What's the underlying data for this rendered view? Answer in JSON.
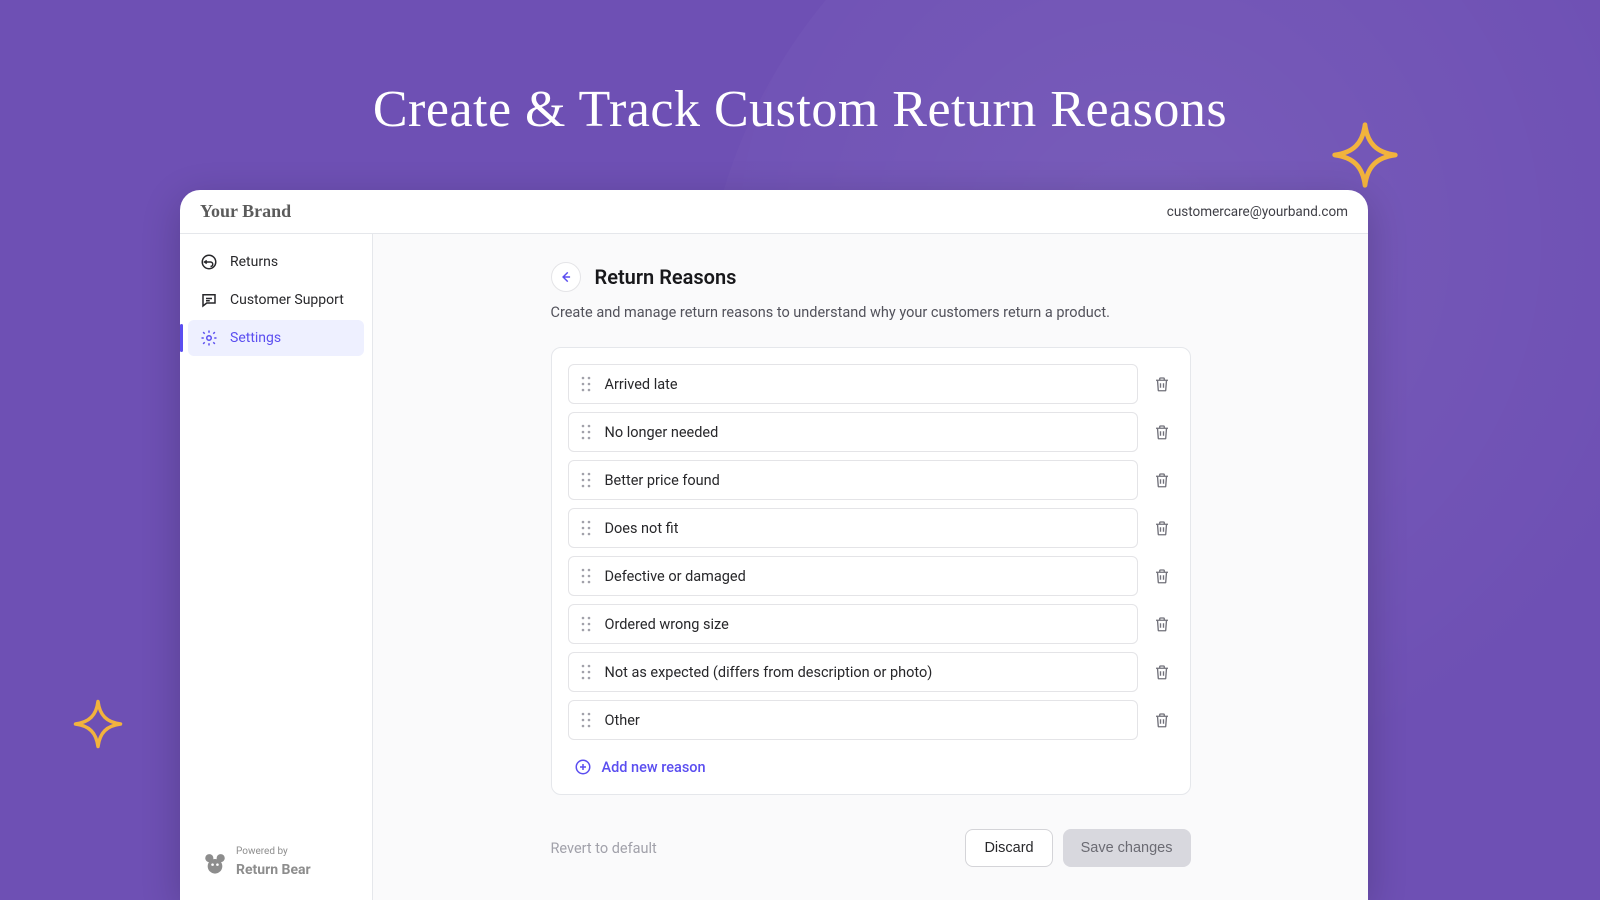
{
  "hero": {
    "title": "Create & Track Custom Return Reasons"
  },
  "header": {
    "brand": "Your Brand",
    "email": "customercare@yourband.com"
  },
  "sidebar": {
    "items": [
      {
        "label": "Returns",
        "active": false
      },
      {
        "label": "Customer Support",
        "active": false
      },
      {
        "label": "Settings",
        "active": true
      }
    ],
    "powered_prefix": "Powered by",
    "powered_name": "Return Bear"
  },
  "page": {
    "title": "Return Reasons",
    "subtitle": "Create and manage return reasons to understand why your customers return a product."
  },
  "reasons": [
    "Arrived late",
    "No longer needed",
    "Better price found",
    "Does not fit",
    "Defective or damaged",
    "Ordered wrong size",
    "Not as expected (differs from description or photo)",
    "Other"
  ],
  "add_label": "Add new reason",
  "footer": {
    "revert": "Revert to default",
    "discard": "Discard",
    "save": "Save changes"
  },
  "colors": {
    "background": "#6e50b4",
    "accent": "#5b4ef0",
    "sparkle": "#f2b33d"
  }
}
